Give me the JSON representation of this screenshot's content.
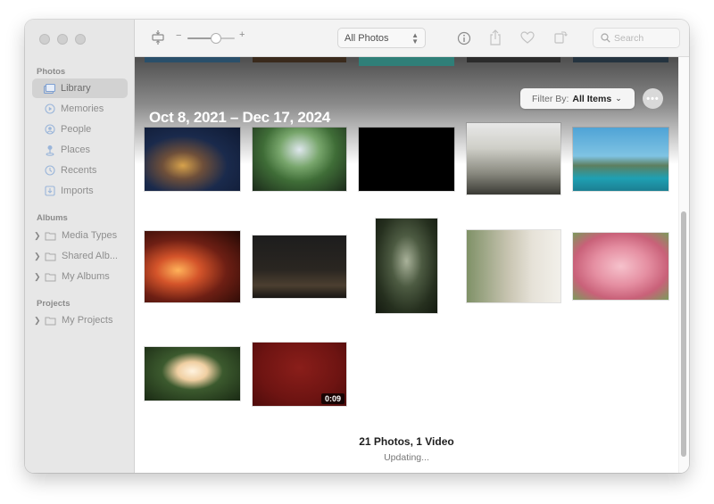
{
  "window": {
    "traffic_lights": [
      "close",
      "minimize",
      "zoom"
    ]
  },
  "sidebar": {
    "sections": [
      {
        "title": "Photos",
        "items": [
          {
            "label": "Library",
            "icon": "library-icon",
            "selected": true
          },
          {
            "label": "Memories",
            "icon": "memories-icon"
          },
          {
            "label": "People",
            "icon": "people-icon"
          },
          {
            "label": "Places",
            "icon": "places-icon"
          },
          {
            "label": "Recents",
            "icon": "recents-icon"
          },
          {
            "label": "Imports",
            "icon": "imports-icon"
          }
        ]
      },
      {
        "title": "Albums",
        "items": [
          {
            "label": "Media Types",
            "icon": "folder-icon"
          },
          {
            "label": "Shared Alb...",
            "icon": "folder-icon"
          },
          {
            "label": "My Albums",
            "icon": "folder-icon"
          }
        ]
      },
      {
        "title": "Projects",
        "items": [
          {
            "label": "My Projects",
            "icon": "folder-icon"
          }
        ]
      }
    ]
  },
  "toolbar": {
    "zoom_minus": "−",
    "zoom_plus": "+",
    "zoom_level": 0.55,
    "view_select": "All Photos",
    "search_placeholder": "Search"
  },
  "content": {
    "date_range": "Oct 8, 2021 – Dec 17, 2024",
    "filter_label": "Filter By:",
    "filter_value": "All Items",
    "more_label": "•••",
    "video_duration": "0:09",
    "count_text": "21 Photos, 1 Video",
    "status_text": "Updating..."
  },
  "colors": {
    "sidebar_bg": "#e7e7e7",
    "selected_item": "#d2d2d2",
    "toolbar_bg": "#f3f3f3"
  }
}
